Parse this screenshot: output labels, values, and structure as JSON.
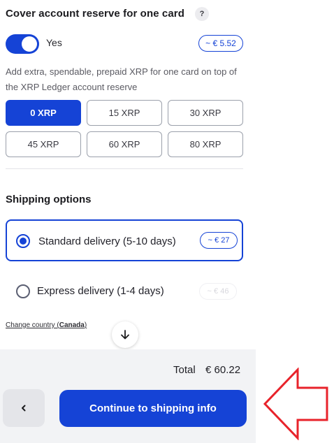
{
  "reserve": {
    "title": "Cover account reserve for one card",
    "help_icon": "?",
    "toggle_label": "Yes",
    "toggle_on": true,
    "price": "~ € 5.52",
    "description": "Add extra, spendable, prepaid XRP for one card on top of the XRP Ledger account reserve",
    "options": [
      "0 XRP",
      "15 XRP",
      "30 XRP",
      "45 XRP",
      "60 XRP",
      "80 XRP"
    ],
    "selected": "0 XRP"
  },
  "shipping": {
    "title": "Shipping options",
    "options": [
      {
        "label": "Standard delivery (5-10 days)",
        "price": "~ € 27",
        "selected": true
      },
      {
        "label": "Express delivery (1-4 days)",
        "price": "~ € 46",
        "selected": false
      }
    ],
    "change_country_prefix": "Change country (",
    "country": "Canada",
    "change_country_suffix": ")"
  },
  "footer": {
    "total_label": "Total",
    "total_value": "€ 60.22",
    "back_icon": "chevron-left-icon",
    "continue_label": "Continue to shipping info"
  },
  "icons": {
    "scroll": "arrow-down-icon",
    "annotation": "red-arrow-left-icon"
  },
  "colors": {
    "accent": "#1543d6",
    "annotation": "#e8232b",
    "footer_bg": "#f2f3f5"
  }
}
